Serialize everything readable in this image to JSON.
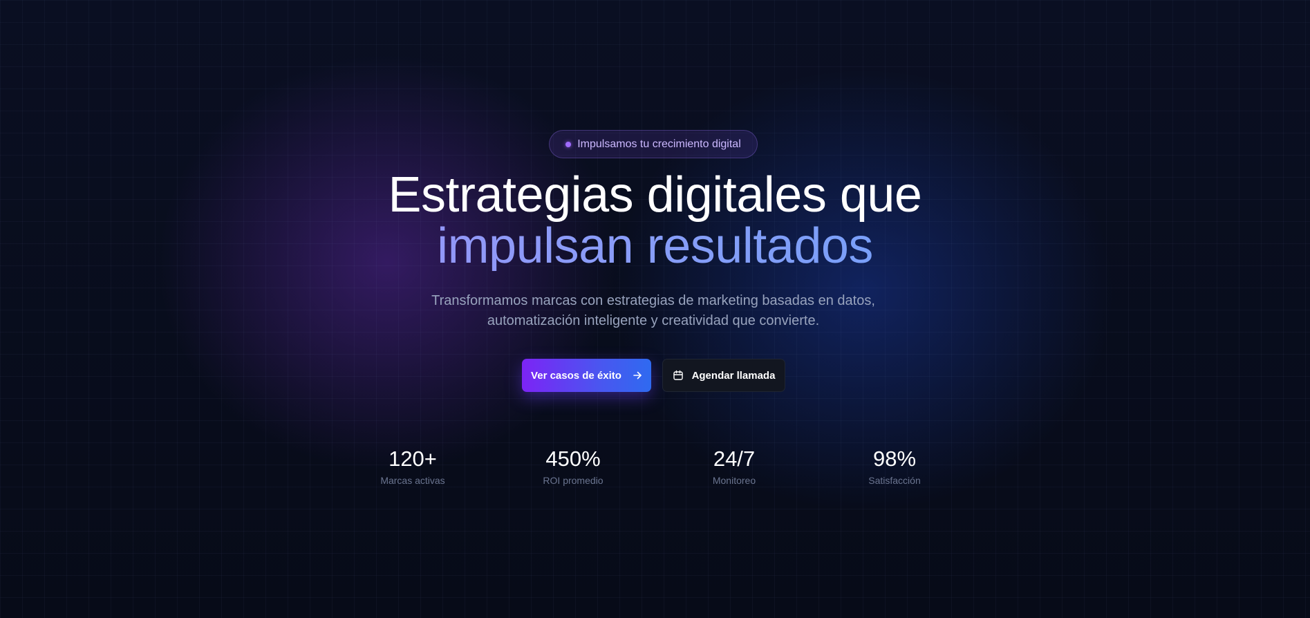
{
  "hero": {
    "badge": "Impulsamos tu crecimiento digital",
    "title_line1": "Estrategias digitales que",
    "title_line2": "impulsan resultados",
    "subtitle": "Transformamos marcas con estrategias de marketing basadas en datos, automatización inteligente y creatividad que convierte."
  },
  "actions": {
    "primary": {
      "label": "Ver casos de éxito",
      "icon": "arrow-right-icon"
    },
    "secondary": {
      "label": "Agendar llamada",
      "icon": "calendar-icon"
    }
  },
  "stats": [
    {
      "value": "120+",
      "label": "Marcas activas"
    },
    {
      "value": "450%",
      "label": "ROI promedio"
    },
    {
      "value": "24/7",
      "label": "Monitoreo"
    },
    {
      "value": "98%",
      "label": "Satisfacción"
    }
  ],
  "colors": {
    "background": "#080c1a",
    "accent_purple": "#7c24f5",
    "accent_blue": "#2f6af0",
    "gradient_text_start": "#a78bfa",
    "gradient_text_end": "#60a5fa"
  }
}
